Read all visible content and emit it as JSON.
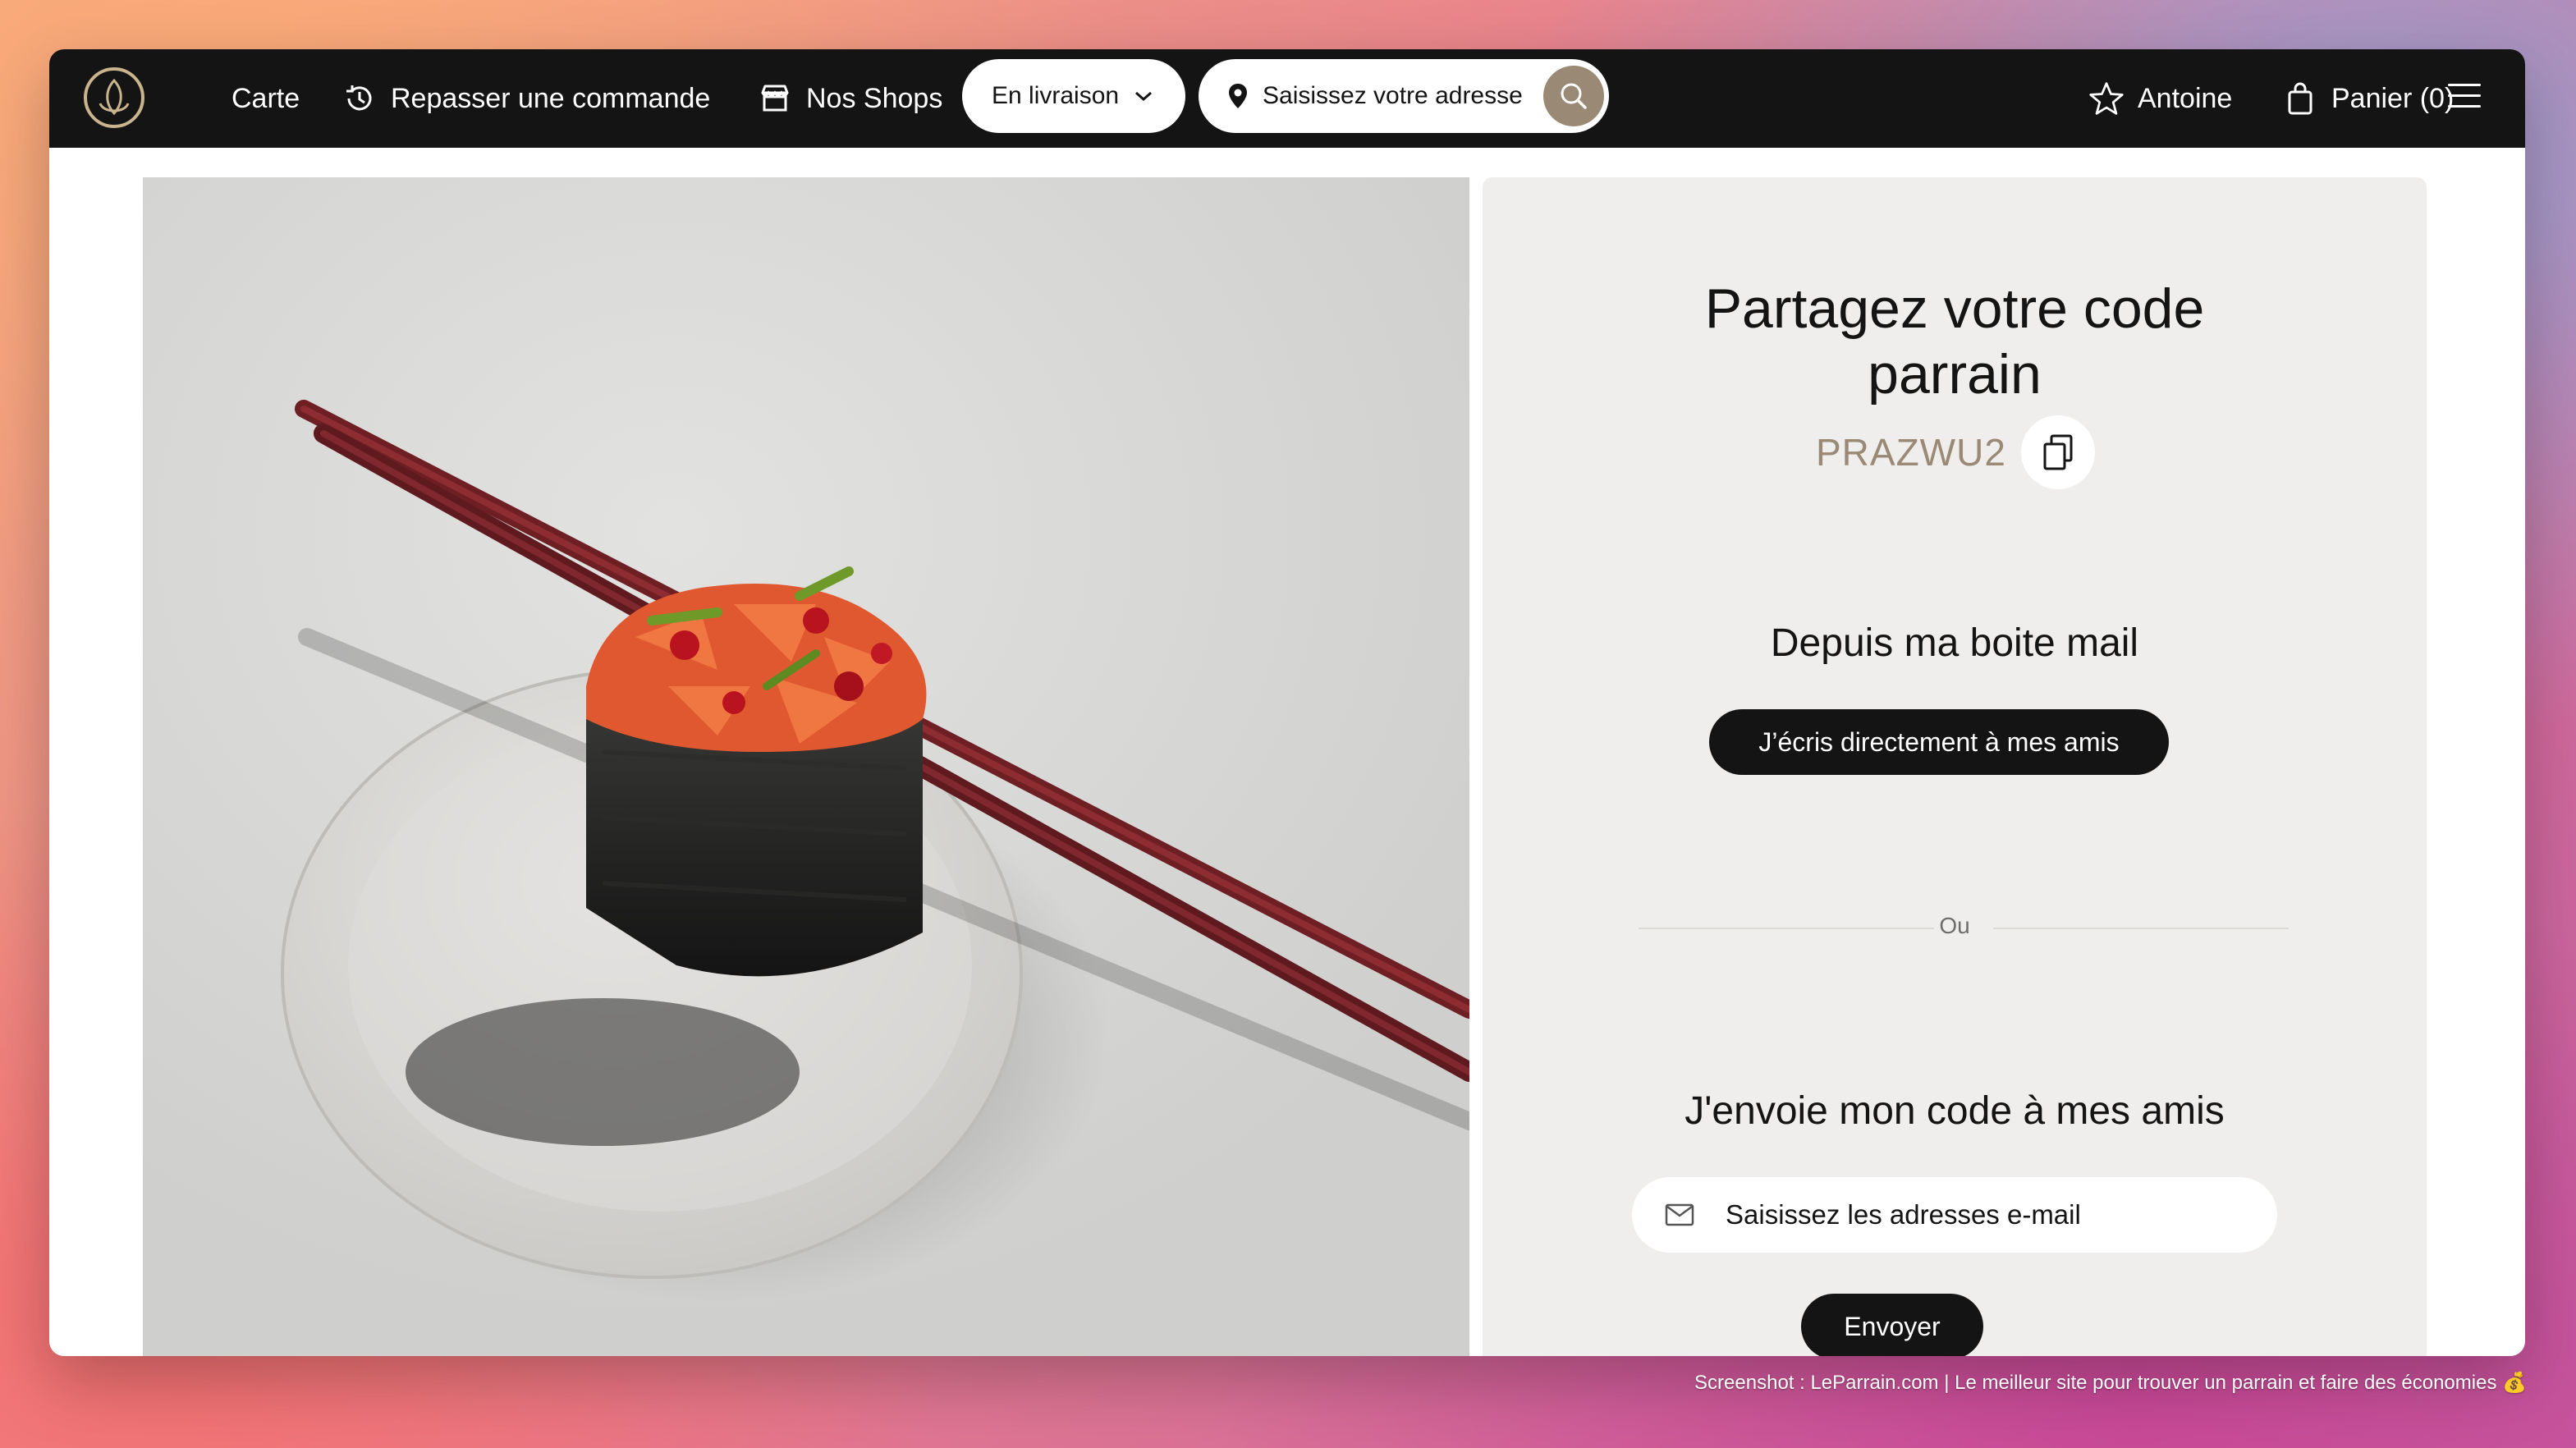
{
  "nav": {
    "carte": "Carte",
    "reorder": "Repasser une commande",
    "shops": "Nos Shops",
    "delivery_mode": "En livraison",
    "address_placeholder": "Saisissez votre adresse",
    "user": "Antoine",
    "cart": "Panier (0)"
  },
  "icons": {
    "logo": "brand-logo-icon",
    "reorder": "clock-history-icon",
    "shops": "store-icon",
    "chevron": "chevron-down-icon",
    "pin": "location-pin-icon",
    "search": "search-icon",
    "user": "star-icon",
    "cart": "shopping-bag-icon",
    "menu": "hamburger-menu-icon",
    "copy": "copy-icon",
    "mail": "mail-icon"
  },
  "referral": {
    "title_line1": "Partagez votre code",
    "title_line2": "parrain",
    "code": "PRAZWU2",
    "mail_section_title": "Depuis ma boite mail",
    "mail_button": "J’écris directement à mes amis",
    "separator": "Ou",
    "send_section_title": "J'envoie mon code à mes amis",
    "email_placeholder": "Saisissez les adresses e-mail",
    "send_button": "Envoyer"
  },
  "footer": {
    "note": "Screenshot : LeParrain.com | Le meilleur site pour trouver un parrain et faire des économies 💰"
  },
  "colors": {
    "nav_bg": "#141414",
    "accent_gold": "#9a8a75",
    "panel_bg": "#efeeec"
  }
}
